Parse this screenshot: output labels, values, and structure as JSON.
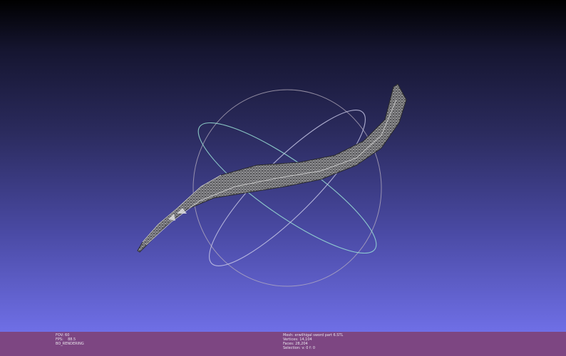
{
  "viewport": {
    "background_top": "#000000",
    "background_bottom": "#6f6fe6",
    "trackball_colors": {
      "horizontal_ring": "#9ae0d6",
      "vertical_ring": "#c7c7e6",
      "side_ring": "#b8b0c0"
    },
    "mesh_color": "#a8a8a8"
  },
  "status_bar": {
    "color": "#7d4682",
    "left": {
      "fov": "FOV: 60",
      "fps": "FPS:    88.5",
      "render_mode": "BO_RENDERING"
    },
    "right": {
      "mesh": "Mesh: erwilhigal sword part 6.STL",
      "vertices": "Vertices: 14,104",
      "faces": "Faces: 28,204",
      "selection": "Selection: v: 0 f: 0"
    }
  }
}
